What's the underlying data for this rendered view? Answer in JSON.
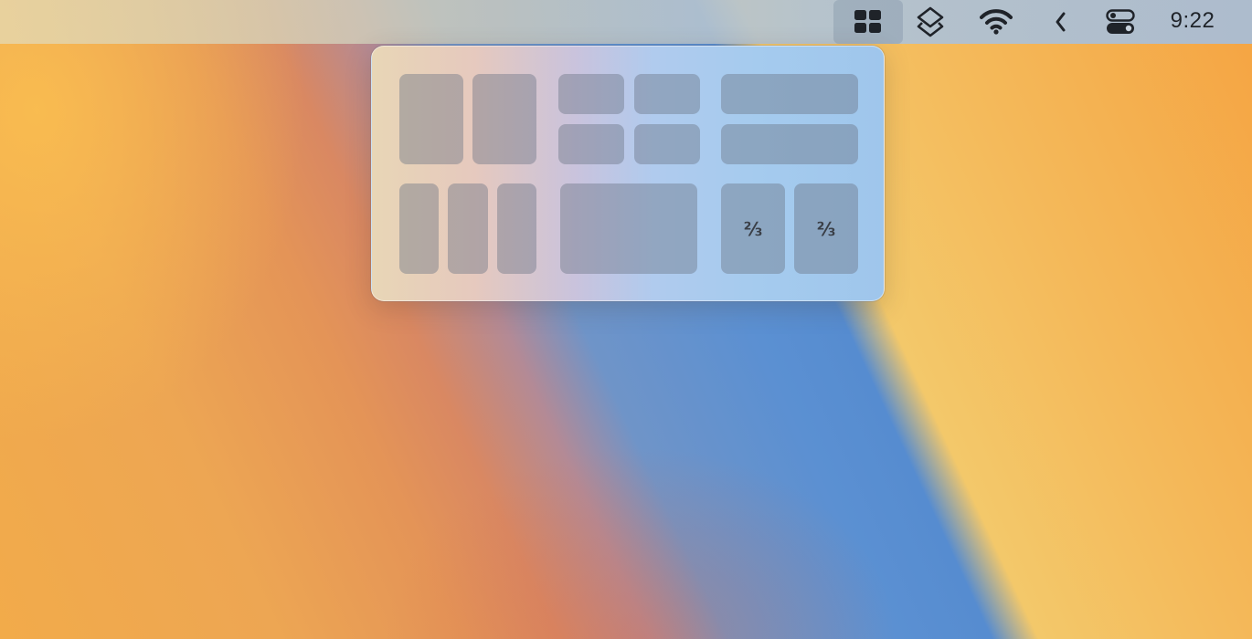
{
  "menubar": {
    "items": [
      {
        "icon": "grid-four-squares-icon",
        "active": true
      },
      {
        "icon": "layers-icon",
        "active": false
      },
      {
        "icon": "wifi-icon",
        "active": false
      },
      {
        "icon": "chevron-left-icon",
        "active": false
      },
      {
        "icon": "control-center-toggles-icon",
        "active": false
      }
    ],
    "clock": "9:22"
  },
  "popover": {
    "layouts": [
      {
        "name": "halves"
      },
      {
        "name": "quarters"
      },
      {
        "name": "horizontal-halves"
      },
      {
        "name": "thirds"
      },
      {
        "name": "maximize"
      },
      {
        "name": "two-thirds",
        "labels": [
          "⅔",
          "⅔"
        ]
      }
    ]
  }
}
